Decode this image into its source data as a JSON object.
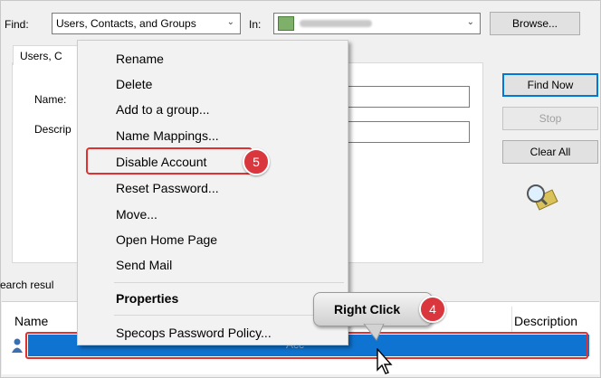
{
  "find": {
    "label": "Find:",
    "value": "Users, Contacts, and Groups"
  },
  "in": {
    "label": "In:",
    "value": "(blurred)"
  },
  "buttons": {
    "browse": "Browse...",
    "find_now": "Find Now",
    "stop": "Stop",
    "clear_all": "Clear All"
  },
  "tab": {
    "label": "Users, C"
  },
  "fields": {
    "name_label": "Name:",
    "description_label": "Descrip"
  },
  "results": {
    "label": "earch resul",
    "columns": [
      "Name",
      "Description"
    ],
    "row_text": "Acc"
  },
  "context_menu": {
    "items": [
      "Rename",
      "Delete",
      "Add to a group...",
      "Name Mappings...",
      "Disable Account",
      "Reset Password...",
      "Move...",
      "Open Home Page",
      "Send Mail",
      "Properties",
      "Specops Password Policy..."
    ]
  },
  "annotations": {
    "step5": "5",
    "right_click": "Right Click",
    "step4": "4"
  },
  "colors": {
    "accent": "#0f74d1",
    "callout_red": "#e03131",
    "badge": "#d9363e"
  },
  "icons": [
    "chevron-down-icon",
    "domain-icon",
    "search-magnifier-icon",
    "user-icon",
    "mouse-pointer-icon"
  ]
}
